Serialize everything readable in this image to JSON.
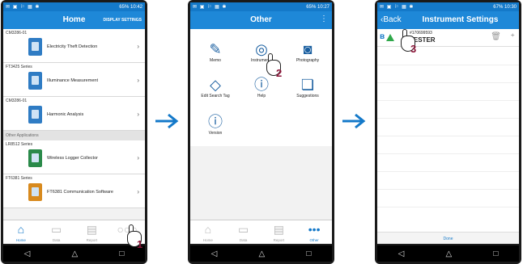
{
  "screen1": {
    "status_time": "10:42",
    "status_battery": "65%",
    "title": "Home",
    "action": "DISPLAY SETTINGS",
    "sections": [
      {
        "series": "CM3286-01",
        "label": "Electricity Theft Detection"
      },
      {
        "series": "FT3425 Series",
        "label": "Illuminance Measurement"
      },
      {
        "series": "CM3286-01",
        "label": "Harmonic Analysis"
      }
    ],
    "group_label": "Other Applications",
    "apps": [
      {
        "series": "LR8512 Series",
        "label": "Wireless Logger Collector"
      },
      {
        "series": "FT6381 Series",
        "label": "FT6381 Communication Software"
      }
    ],
    "tabs": [
      "Home",
      "Data",
      "Report",
      "Other"
    ]
  },
  "screen2": {
    "status_time": "10:27",
    "status_battery": "65%",
    "title": "Other",
    "items": [
      {
        "label": "Memo",
        "icon": "pencil-icon"
      },
      {
        "label": "Instruments",
        "icon": "wifi-instrument-icon"
      },
      {
        "label": "Photography",
        "icon": "camera-icon"
      },
      {
        "label": "Edit Search Tag",
        "icon": "tag-icon"
      },
      {
        "label": "Help",
        "icon": "help-icon"
      },
      {
        "label": "Suggestions",
        "icon": "chat-bubbles-icon"
      },
      {
        "label": "Version",
        "icon": "info-icon"
      }
    ],
    "tabs": [
      "Home",
      "Data",
      "Report",
      "Other"
    ]
  },
  "screen3": {
    "status_time": "10:30",
    "status_battery": "67%",
    "back_label": "Back",
    "title": "Instrument Settings",
    "device_serial": "#170699593",
    "device_name": "TESTER",
    "done_label": "Done"
  },
  "steps": [
    "1",
    "2",
    "3"
  ],
  "colors": {
    "accent": "#1e88d8",
    "arrow": "#1479c9",
    "step": "#8a1538"
  }
}
